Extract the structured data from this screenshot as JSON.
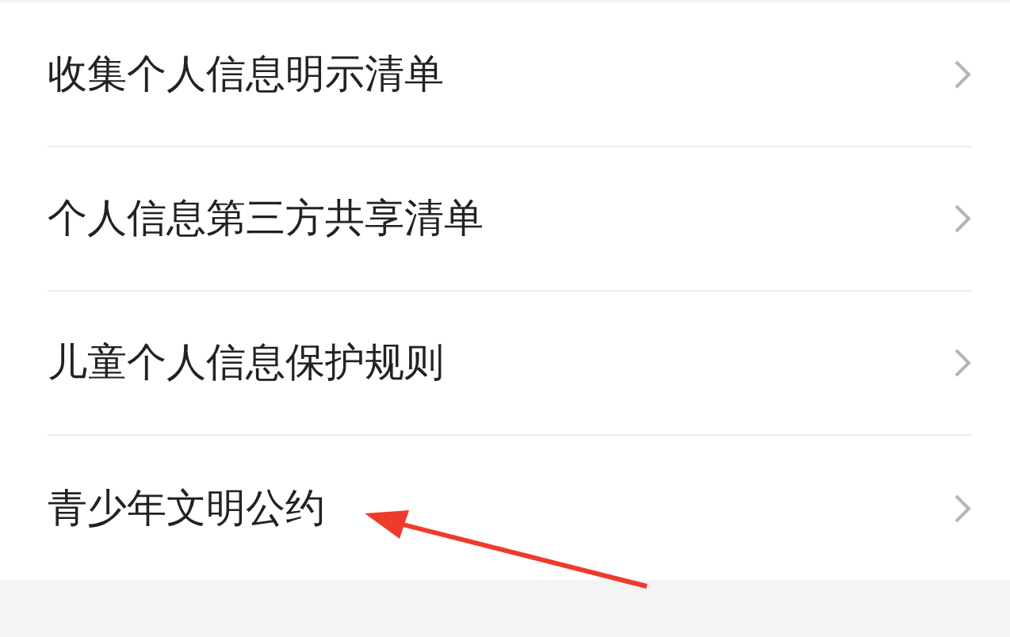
{
  "menu": {
    "items": [
      {
        "label": "收集个人信息明示清单"
      },
      {
        "label": "个人信息第三方共享清单"
      },
      {
        "label": "儿童个人信息保护规则"
      },
      {
        "label": "青少年文明公约"
      }
    ]
  }
}
